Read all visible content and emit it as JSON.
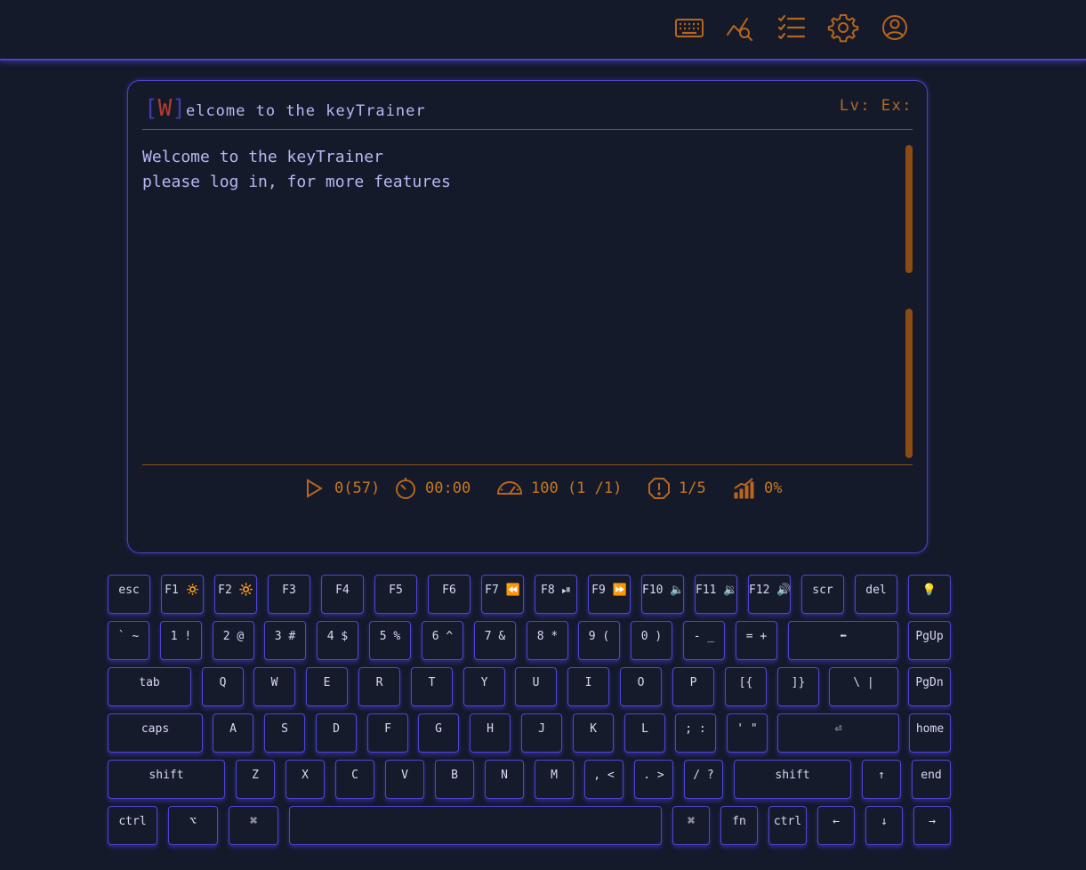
{
  "nav": {
    "icons": [
      "keyboard-icon",
      "chart-search-icon",
      "checklist-icon",
      "gear-icon",
      "user-circle-icon"
    ]
  },
  "panel": {
    "title_bracket_open": "[",
    "title_initial": "W",
    "title_bracket_close": "]",
    "title_rest": "elcome to the keyTrainer",
    "level_text": "Lv: Ex:",
    "lines": [
      "Welcome to the keyTrainer",
      "please log in, for more features"
    ]
  },
  "stats": {
    "progress": "0(57)",
    "time": "00:00",
    "speed": "100 (1 /1)",
    "errors": "1/5",
    "accuracy": "0%"
  },
  "keyboard": {
    "row1": [
      "esc",
      "F1 🔅",
      "F2 🔆",
      "F3",
      "F4",
      "F5",
      "F6",
      "F7 ⏪",
      "F8 ⏯",
      "F9 ⏩",
      "F10 🔈",
      "F11 🔉",
      "F12 🔊",
      "scr",
      "del",
      "💡"
    ],
    "row2": [
      "` ~",
      "1 !",
      "2 @",
      "3 #",
      "4 $",
      "5 %",
      "6 ^",
      "7 &",
      "8 *",
      "9 (",
      "0 )",
      "- _",
      "= +",
      "⬅",
      "PgUp"
    ],
    "row3": [
      "tab",
      "Q",
      "W",
      "E",
      "R",
      "T",
      "Y",
      "U",
      "I",
      "O",
      "P",
      "[{",
      "]}",
      "\\ |",
      "PgDn"
    ],
    "row4": [
      "caps",
      "A",
      "S",
      "D",
      "F",
      "G",
      "H",
      "J",
      "K",
      "L",
      "; :",
      "' \"",
      "⏎",
      "home"
    ],
    "row5": [
      "shift",
      "Z",
      "X",
      "C",
      "V",
      "B",
      "N",
      "M",
      ", <",
      ". >",
      "/ ?",
      "shift",
      "↑",
      "end"
    ],
    "row6": [
      "ctrl",
      "⌥",
      "⌘",
      "",
      "⌘",
      "fn",
      "ctrl",
      "←",
      "↓",
      "→"
    ]
  },
  "colors": {
    "background": "#141a2a",
    "accent_border": "#4f46d6",
    "orange": "#c9771f",
    "text": "#b7b9f2"
  }
}
